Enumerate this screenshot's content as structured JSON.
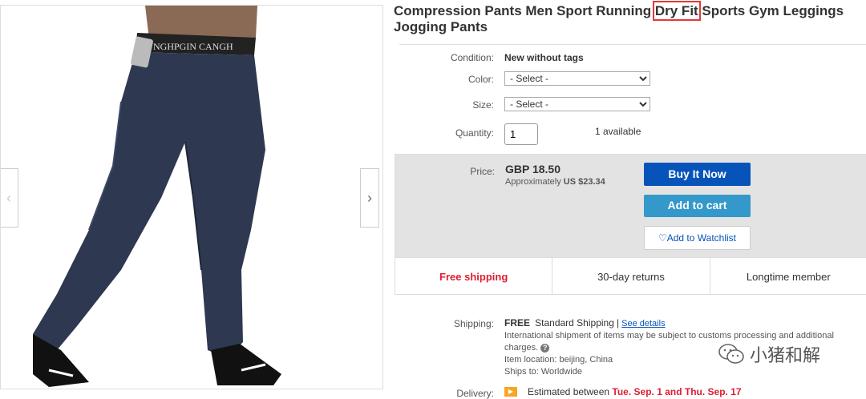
{
  "product": {
    "title_pre": "Compression Pants Men Sport Running ",
    "title_highlight": "Dry Fit",
    "title_post": " Sports Gym Leggings Jogging Pants",
    "waistband_text": "NGHPGIN  CANGH"
  },
  "details": {
    "condition_label": "Condition:",
    "condition_value": "New without tags",
    "color_label": "Color:",
    "color_selected": "- Select -",
    "size_label": "Size:",
    "size_selected": "- Select -",
    "quantity_label": "Quantity:",
    "quantity_value": "1",
    "available": "1 available"
  },
  "price": {
    "label": "Price:",
    "amount": "GBP 18.50",
    "approx_prefix": "Approximately ",
    "approx_value": "US $23.34",
    "buy_now": "Buy It Now",
    "add_to_cart": "Add to cart",
    "watchlist": "Add to Watchlist"
  },
  "features": [
    "Free shipping",
    "30-day returns",
    "Longtime member"
  ],
  "shipping": {
    "label": "Shipping:",
    "free": "FREE",
    "method": "Standard Shipping",
    "see_details": "See details",
    "intl_note": "International shipment of items may be subject to customs processing and additional charges.",
    "location_label": "Item location:",
    "location_value": "beijing, China",
    "ships_to_label": "Ships to:",
    "ships_to_value": "Worldwide"
  },
  "delivery": {
    "label": "Delivery:",
    "text": "Estimated between ",
    "dates": "Tue. Sep. 1 and Thu. Sep. 17"
  },
  "watermark": {
    "text": "小猪和解"
  },
  "colors": {
    "blue": "#0654ba",
    "cart": "#3498ca",
    "red": "#dd1e31",
    "highlight_box": "#e53935"
  },
  "icons": [
    "chevron-left-icon",
    "chevron-right-icon",
    "heart-icon",
    "info-icon",
    "delivery-icon",
    "wechat-icon"
  ]
}
